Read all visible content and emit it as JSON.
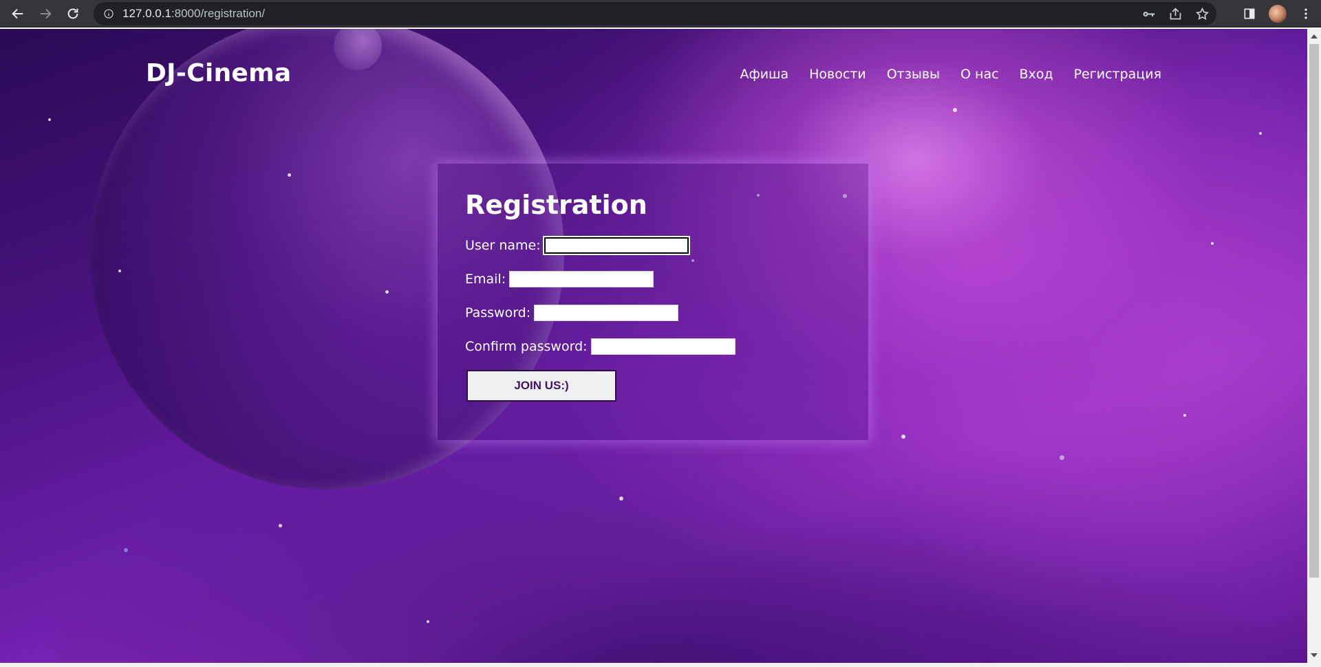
{
  "browser": {
    "url_host": "127.0.0.1",
    "url_rest": ":8000/registration/",
    "icons": {
      "back": "arrow-left-icon",
      "forward": "arrow-right-icon",
      "reload": "reload-icon",
      "site_info": "info-icon",
      "password_key": "key-icon",
      "share": "share-icon",
      "bookmark": "star-icon",
      "side_panel": "side-panel-icon",
      "menu": "kebab-menu-icon"
    }
  },
  "site": {
    "logo": "DJ-Cinema",
    "nav": [
      "Афиша",
      "Новости",
      "Отзывы",
      "О нас",
      "Вход",
      "Регистрация"
    ]
  },
  "form": {
    "title": "Registration",
    "fields": [
      {
        "label": "User name:",
        "value": ""
      },
      {
        "label": "Email:",
        "value": ""
      },
      {
        "label": "Password:",
        "value": ""
      },
      {
        "label": "Confirm password:",
        "value": ""
      }
    ],
    "submit_label": "JOIN US:)"
  },
  "colors": {
    "background_accent": "#8a2ac0",
    "card_glow": "#be78f0",
    "button_text": "#3b1660"
  }
}
